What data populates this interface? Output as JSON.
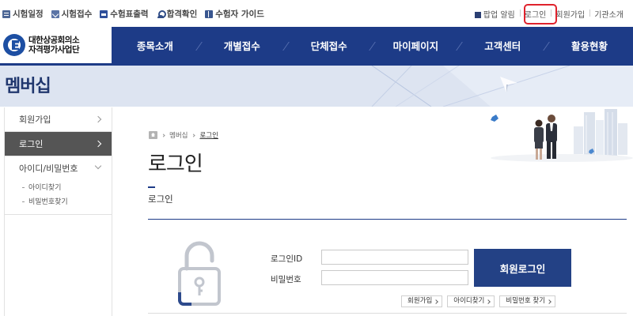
{
  "util_bar": {
    "left_items": [
      {
        "label": "시험일정",
        "icon": "calendar-icon"
      },
      {
        "label": "시험접수",
        "icon": "document-icon"
      },
      {
        "label": "수험표출력",
        "icon": "print-icon"
      },
      {
        "label": "합격확인",
        "icon": "person-icon"
      },
      {
        "label": "수험자 가이드",
        "icon": "guide-icon"
      }
    ],
    "right_items": {
      "popup": "팝업 알림",
      "login": "로그인",
      "join": "회원가입",
      "org": "기관소개"
    }
  },
  "logo": {
    "line1": "대한상공회의소",
    "line2": "자격평가사업단"
  },
  "gnb": [
    "종목소개",
    "개별접수",
    "단체접수",
    "마이페이지",
    "고객센터",
    "활용현황"
  ],
  "banner": {
    "title": "멤버십"
  },
  "sidebar": {
    "items": [
      {
        "label": "회원가입"
      },
      {
        "label": "로그인"
      },
      {
        "label": "아이디/비밀번호"
      }
    ],
    "sub_items": [
      "아이디찾기",
      "비밀번호찾기"
    ]
  },
  "breadcrumb": {
    "level1": "멤버십",
    "current": "로그인"
  },
  "page": {
    "title": "로그인",
    "tab_label": "로그인"
  },
  "login_form": {
    "id_label": "로그인ID",
    "pw_label": "비밀번호",
    "id_value": "",
    "pw_value": "",
    "submit_label": "회원로그인",
    "links": [
      "회원가입",
      "아이디찾기",
      "비밀번호 찾기"
    ]
  },
  "colors": {
    "brand_navy": "#1d3b87",
    "highlight_red": "#e0222c",
    "sidebar_active": "#555555"
  }
}
